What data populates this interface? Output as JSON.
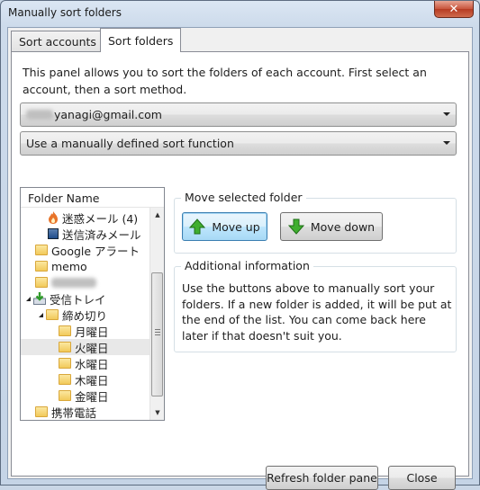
{
  "window": {
    "title": "Manually sort folders",
    "close_glyph": "✕"
  },
  "tabs": [
    {
      "label": "Sort accounts",
      "active": false
    },
    {
      "label": "Sort folders",
      "active": true
    }
  ],
  "description": "This panel allows you to sort the folders of each account. First select an account, then a sort method.",
  "account_select": {
    "value": "yanagi@gmail.com"
  },
  "sort_method_select": {
    "value": "Use a manually defined sort function"
  },
  "tree": {
    "header": "Folder Name",
    "rows": [
      {
        "label": "迷惑メール (4)",
        "icon": "junk-flame-icon"
      },
      {
        "label": "送信済みメール",
        "icon": "sent-icon"
      },
      {
        "label": "Google アラート",
        "icon": "folder-icon"
      },
      {
        "label": "memo",
        "icon": "folder-icon"
      },
      {
        "label": "",
        "icon": "folder-icon"
      },
      {
        "label": "受信トレイ",
        "icon": "inbox-icon"
      },
      {
        "label": "締め切り",
        "icon": "folder-icon"
      },
      {
        "label": "月曜日",
        "icon": "folder-icon"
      },
      {
        "label": "火曜日",
        "icon": "folder-icon",
        "selected": true
      },
      {
        "label": "水曜日",
        "icon": "folder-icon"
      },
      {
        "label": "木曜日",
        "icon": "folder-icon"
      },
      {
        "label": "金曜日",
        "icon": "folder-icon"
      },
      {
        "label": "携帯電話",
        "icon": "folder-icon"
      }
    ]
  },
  "move_group": {
    "label": "Move selected folder",
    "move_up": "Move up",
    "move_down": "Move down"
  },
  "info_group": {
    "label": "Additional information",
    "text": "Use the buttons above to manually sort your folders. If a new folder is added, it will be put at the end of the list. You can come back here later if that doesn't suit you."
  },
  "footer": {
    "refresh": "Refresh folder pane",
    "close": "Close"
  },
  "colors": {
    "up_arrow": "#3fae2f",
    "down_arrow": "#3fae2f",
    "junk": "#e8742a"
  }
}
